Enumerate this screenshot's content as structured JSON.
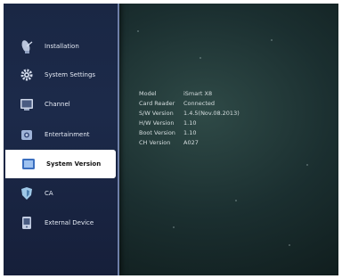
{
  "menu": {
    "items": [
      {
        "label": "Installation",
        "icon": "satellite-dish-icon"
      },
      {
        "label": "System Settings",
        "icon": "gear-icon"
      },
      {
        "label": "Channel",
        "icon": "tv-icon"
      },
      {
        "label": "Entertainment",
        "icon": "camera-icon"
      },
      {
        "label": "System Version",
        "icon": "info-icon",
        "selected": true
      },
      {
        "label": "CA",
        "icon": "shield-icon"
      },
      {
        "label": "External Device",
        "icon": "device-icon"
      }
    ]
  },
  "system_info": {
    "model_label": "Model",
    "model_value": "iSmart X8",
    "card_reader_label": "Card Reader",
    "card_reader_value": "Connected",
    "sw_label": "S/W Version",
    "sw_value": "1.4.5(Nov.08.2013)",
    "hw_label": "H/W Version",
    "hw_value": "1.10",
    "boot_label": "Boot Version",
    "boot_value": "1.10",
    "ch_label": "CH Version",
    "ch_value": "A027"
  },
  "colors": {
    "sidebar_bg": "#1a2744",
    "selected_bg": "#ffffff",
    "content_bg": "#1b2f30"
  }
}
